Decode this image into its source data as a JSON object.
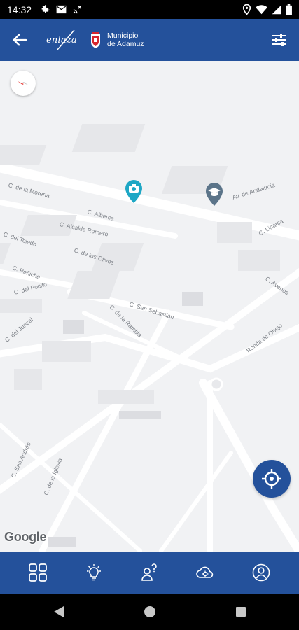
{
  "status_bar": {
    "time": "14:32",
    "icons_left": [
      "settings-icon",
      "mail-icon",
      "cast-icon"
    ],
    "icons_right": [
      "location-icon",
      "wifi-icon",
      "signal-icon",
      "battery-icon"
    ]
  },
  "app_bar": {
    "back_icon": "arrow-left-icon",
    "logo_enlaza": "enlaza",
    "municipality_line1": "Municipio",
    "municipality_line2": "de Adamuz",
    "settings_icon": "sliders-icon"
  },
  "map": {
    "streets": [
      "C. de la Morería",
      "Av. de Andalucía",
      "C. Alcalde Romero",
      "C. Alberca",
      "C. del Toledo",
      "C. de los Olivos",
      "C. Peñiche",
      "C. del Pocito",
      "C. San Sebastián",
      "C. de la Rambla",
      "C. del Juncal",
      "C. Avenos",
      "Ronda de Obejo",
      "C. Linarca",
      "C. San Andrés",
      "C. de la Iglesia"
    ],
    "attribution": "Google",
    "compass_icon": "compass-icon",
    "pins": [
      "camera-pin-icon",
      "school-pin-icon"
    ],
    "colors": {
      "camera_pin": "#1ea7c5",
      "school_pin": "#5b7489",
      "compass_needle": "#e53935"
    },
    "locate_icon": "crosshair-icon"
  },
  "bottom_nav": {
    "items": [
      "grid-icon",
      "lightbulb-icon",
      "help-person-icon",
      "cloud-sun-icon",
      "profile-icon"
    ]
  },
  "system_nav": [
    "back-triangle-icon",
    "home-circle-icon",
    "recents-square-icon"
  ],
  "colors": {
    "primary": "#24519b",
    "map_background": "#f1f2f4"
  }
}
